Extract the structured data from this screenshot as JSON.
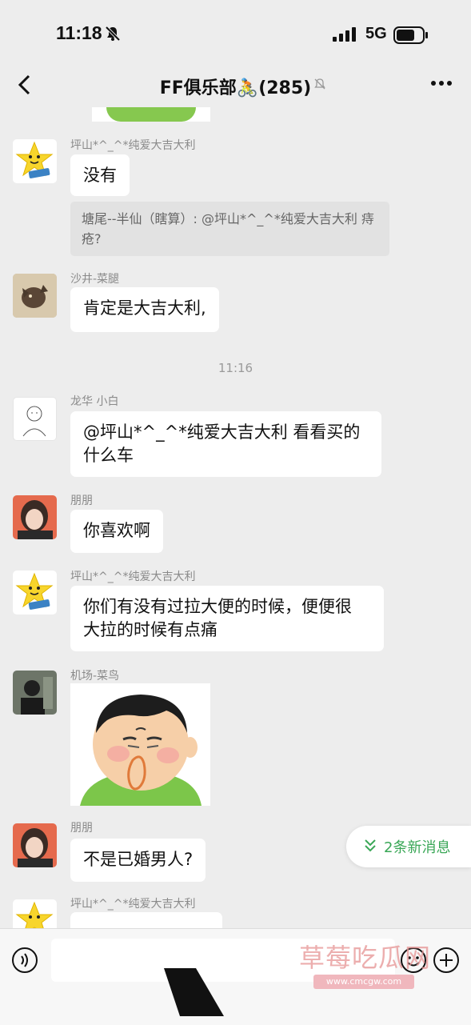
{
  "status_bar": {
    "time": "11:18",
    "network": "5G"
  },
  "header": {
    "title": "FF俱乐部🚴(285)"
  },
  "messages": [
    {
      "sender": "坪山*^_^*纯爱大吉大利",
      "text": "没有",
      "quote": "塘尾--半仙（瞎算）: @坪山*^_^*纯爱大吉大利 痔疮?"
    },
    {
      "sender": "沙井-菜腿",
      "text": "肯定是大吉大利,"
    },
    {
      "timestamp": "11:16"
    },
    {
      "sender": "龙华 小白",
      "line1": "@坪山*^_^*纯爱大吉大利 看看买的",
      "line2": "什么车"
    },
    {
      "sender": "朋朋",
      "text": "你喜欢啊"
    },
    {
      "sender": "坪山*^_^*纯爱大吉大利",
      "line1": "你们有没有过拉大便的时候，便便很",
      "line2": "大拉的时候有点痛"
    },
    {
      "sender": "机场-菜鸟",
      "sticker": "nose-picking-man-sticker"
    },
    {
      "sender": "朋朋",
      "text": "不是已婚男人?"
    },
    {
      "sender": "坪山*^_^*纯爱大吉大利"
    }
  ],
  "new_messages_badge": "2条新消息",
  "watermark": {
    "text": "草莓吃瓜网",
    "url": "www.cmcgw.com"
  },
  "icons": [
    "back-arrow-icon",
    "more-icon",
    "bell-off-icon",
    "signal-icon",
    "battery-icon",
    "voice-icon",
    "emoji-icon",
    "plus-icon",
    "double-chevron-down-icon"
  ],
  "colors": {
    "background": "#ededed",
    "bubble": "#ffffff",
    "accent_green": "#3aa757"
  }
}
